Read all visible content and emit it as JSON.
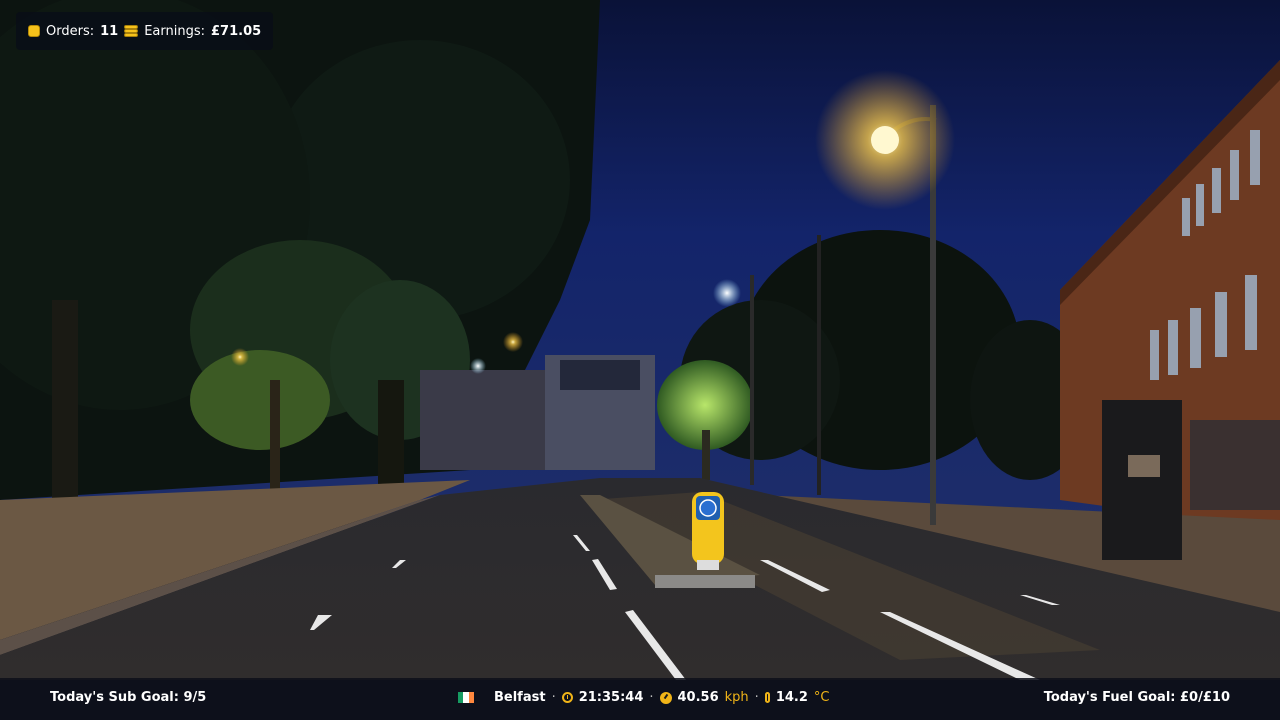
{
  "hud_top": {
    "orders_label": "Orders:",
    "orders_value": "11",
    "earnings_label": "Earnings:",
    "earnings_value": "£71.05",
    "icons": [
      "bag-icon",
      "coins-icon"
    ]
  },
  "hud_bottom": {
    "sub_goal": "Today's Sub Goal: 9/5",
    "fuel_goal": "Today's Fuel Goal: £0/£10",
    "location": "Belfast",
    "time": "21:35:44",
    "speed_value": "40.56",
    "speed_unit": "kph",
    "temp_value": "14.2",
    "temp_unit": "°C",
    "separator": "·",
    "flag_colors": [
      "#169b62",
      "#ffffff",
      "#ff883e"
    ]
  },
  "scene": {
    "description_colors": {
      "sky": "#0f1c52",
      "road": "#2b2a2c",
      "streetlight": "#ffd35a"
    }
  }
}
